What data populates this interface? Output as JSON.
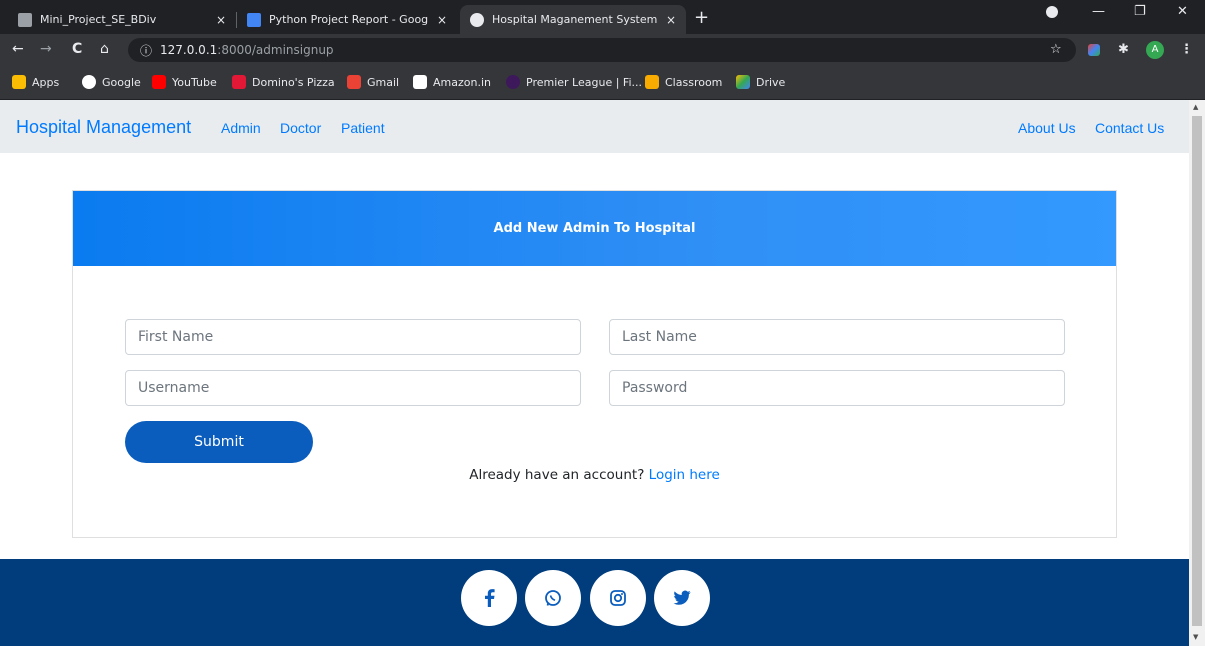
{
  "browser": {
    "tabs": [
      {
        "title": "Mini_Project_SE_BDiv",
        "close": "×"
      },
      {
        "title": "Python Project Report - Google D",
        "close": "×"
      },
      {
        "title": "Hospital Maganement System",
        "close": "×"
      }
    ],
    "new_tab": "+",
    "window_controls": {
      "minimize": "—",
      "maximize": "❐",
      "close": "✕"
    },
    "nav": {
      "back": "←",
      "forward": "→",
      "reload": "C",
      "home": "⌂"
    },
    "address": {
      "info_icon": "ⓘ",
      "host": "127.0.0.1",
      "path": ":8000/adminsignup"
    },
    "profile_initial": "A",
    "bookmarks": [
      {
        "label": "Apps",
        "icon": "apps-grid-icon",
        "color": "#fbbc04"
      },
      {
        "label": "Google",
        "icon": "google-icon",
        "color": "#ffffff"
      },
      {
        "label": "YouTube",
        "icon": "youtube-icon",
        "color": "#ff0000"
      },
      {
        "label": "Domino's Pizza",
        "icon": "dominos-icon",
        "color": "#e31837"
      },
      {
        "label": "Gmail",
        "icon": "gmail-icon",
        "color": "#ea4335"
      },
      {
        "label": "Amazon.in",
        "icon": "amazon-icon",
        "color": "#ffffff"
      },
      {
        "label": "Premier League | Fi...",
        "icon": "premier-league-icon",
        "color": "#3d195b"
      },
      {
        "label": "Classroom",
        "icon": "classroom-icon",
        "color": "#f9ab00"
      },
      {
        "label": "Drive",
        "icon": "drive-icon",
        "color": "#34a853"
      }
    ]
  },
  "navbar": {
    "brand": "Hospital Management",
    "left_links": [
      "Admin",
      "Doctor",
      "Patient"
    ],
    "right_links": [
      "About Us",
      "Contact Us"
    ]
  },
  "form": {
    "header": "Add New Admin To Hospital",
    "first_name_placeholder": "First Name",
    "last_name_placeholder": "Last Name",
    "username_placeholder": "Username",
    "password_placeholder": "Password",
    "submit_label": "Submit",
    "already_text": "Already have an account?",
    "login_link": "Login here"
  },
  "footer": {
    "social": [
      "facebook-icon",
      "whatsapp-icon",
      "instagram-icon",
      "twitter-icon"
    ]
  },
  "colors": {
    "brand_blue": "#007bff",
    "header_gradient_start": "#0a7bf0",
    "header_gradient_end": "#3399ff",
    "submit_blue": "#0b5dbd",
    "footer_blue": "#013d7c"
  }
}
